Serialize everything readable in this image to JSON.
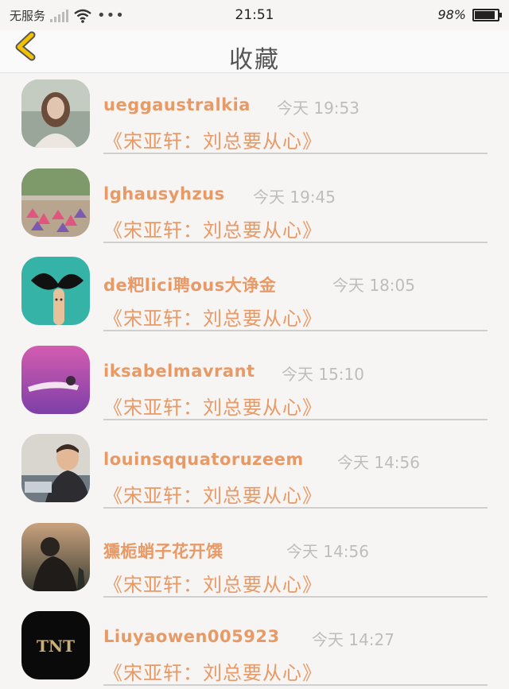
{
  "status_bar": {
    "carrier": "无服务",
    "time": "21:51",
    "battery_percent": "98%",
    "battery_level": 0.98
  },
  "header": {
    "title": "收藏"
  },
  "favorites": [
    {
      "username": "ueggaustralkia",
      "time": "今天 19:53",
      "post": "《宋亚轩：刘总要从心》"
    },
    {
      "username": "lghausyhzus",
      "time": "今天 19:45",
      "post": "《宋亚轩：刘总要从心》"
    },
    {
      "username": "de粑lici聘ous大诤金",
      "time": "今天 18:05",
      "post": "《宋亚轩：刘总要从心》"
    },
    {
      "username": "iksabelmavrant",
      "time": "今天 15:10",
      "post": "《宋亚轩：刘总要从心》"
    },
    {
      "username": "louinsqquatoruzeem",
      "time": "今天 14:56",
      "post": "《宋亚轩：刘总要从心》"
    },
    {
      "username": "獯栀蛸子花开馔",
      "time": "今天 14:56",
      "post": "《宋亚轩：刘总要从心》"
    },
    {
      "username": "Liuyaowen005923",
      "time": "今天 14:27",
      "post": "《宋亚轩：刘总要从心》"
    }
  ],
  "avatar_art": {
    "tnt_logo_text": "TNT"
  },
  "colors": {
    "accent": "#e89a66",
    "timestamp": "#bdbdbd",
    "back_arrow": "#f2c200"
  }
}
